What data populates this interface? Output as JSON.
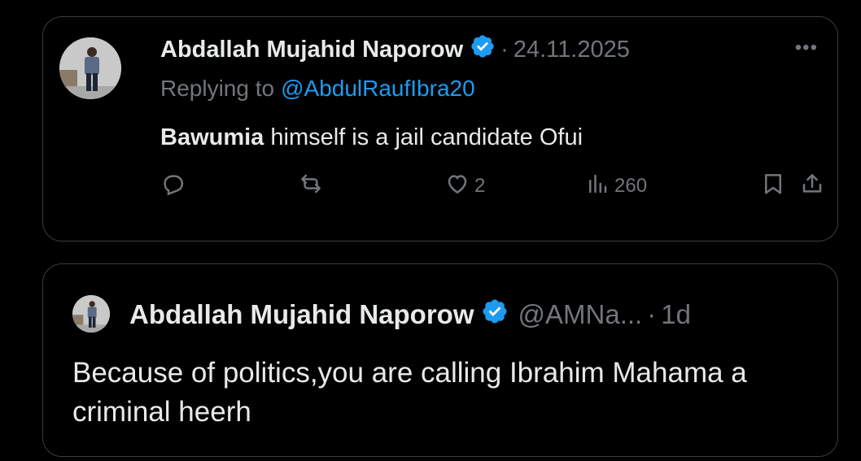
{
  "reply_tweet": {
    "author_name": "Abdallah Mujahid Naporow",
    "date": "24.11.2025",
    "replying_to_label": "Replying to",
    "replying_to_handle": "@AbdulRaufIbra20",
    "text_bold": "Bawumia",
    "text_rest": " himself is a jail candidate Ofui",
    "more_label": "•••",
    "actions": {
      "reply_count": "",
      "retweet_count": "",
      "like_count": "2",
      "views_count": "260"
    },
    "accent_color": "#1d9bf0",
    "icons": [
      "verified-badge-icon",
      "more-icon",
      "reply-icon",
      "retweet-icon",
      "like-icon",
      "views-icon",
      "bookmark-icon",
      "share-icon"
    ]
  },
  "quoted_tweet": {
    "author_name": "Abdallah Mujahid Naporow",
    "handle": "@AMNa...",
    "time": "1d",
    "text": "Because of politics,you are calling Ibrahim Mahama a criminal heerh"
  }
}
